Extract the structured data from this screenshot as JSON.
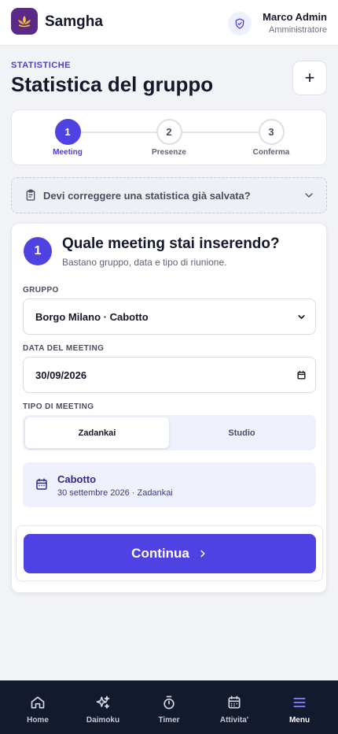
{
  "header": {
    "app_name": "Samgha",
    "user_name": "Marco Admin",
    "user_role": "Amministratore",
    "logo_icon": "lotus-icon",
    "role_icon": "shield-check-icon"
  },
  "page": {
    "eyebrow": "STATISTICHE",
    "title": "Statistica del gruppo",
    "add_label": "+"
  },
  "stepper": {
    "steps": [
      {
        "number": "1",
        "label": "Meeting",
        "active": true
      },
      {
        "number": "2",
        "label": "Presenze",
        "active": false
      },
      {
        "number": "3",
        "label": "Conferma",
        "active": false
      }
    ]
  },
  "correction": {
    "text": "Devi correggere una statistica già salvata?",
    "icon": "clipboard-icon"
  },
  "form": {
    "step_number": "1",
    "title": "Quale meeting stai inserendo?",
    "subtitle": "Bastano gruppo, data e tipo di riunione.",
    "group_label": "GRUPPO",
    "group_value": "Borgo Milano · Cabotto",
    "date_label": "DATA DEL MEETING",
    "date_value": "30/09/2026",
    "type_label": "TIPO DI MEETING",
    "types": [
      {
        "label": "Zadankai",
        "active": true
      },
      {
        "label": "Studio",
        "active": false
      }
    ],
    "summary_title": "Cabotto",
    "summary_sub": "30 settembre 2026 · Zadankai",
    "continue_label": "Continua"
  },
  "colors": {
    "accent": "#4f42e3",
    "nav_bg": "#141a2e",
    "logo_bg": "#5b2a86"
  },
  "nav": {
    "items": [
      {
        "label": "Home",
        "icon": "home-icon"
      },
      {
        "label": "Daimoku",
        "icon": "sparkles-icon"
      },
      {
        "label": "Timer",
        "icon": "stopwatch-icon"
      },
      {
        "label": "Attivita'",
        "icon": "calendar-icon"
      },
      {
        "label": "Menu",
        "icon": "menu-icon",
        "active": true
      }
    ]
  }
}
